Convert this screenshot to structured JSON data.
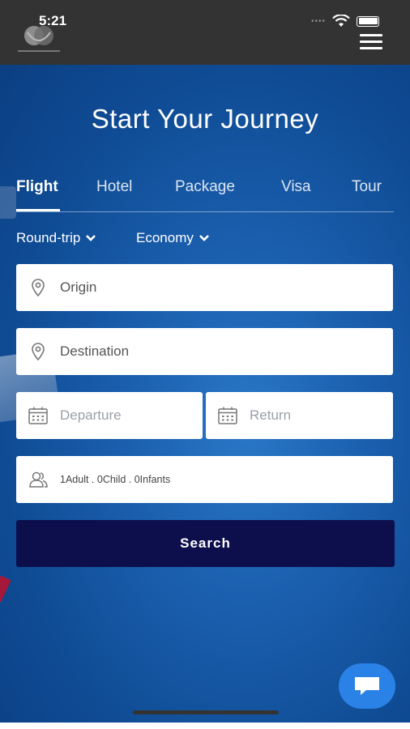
{
  "status_bar": {
    "time": "5:21",
    "dots": "•••• "
  },
  "header": {
    "logo_icon": "company-logo-icon",
    "menu_icon": "hamburger-menu-icon"
  },
  "hero": {
    "title": "Start Your Journey"
  },
  "tabs": [
    {
      "label": "Flight",
      "active": true
    },
    {
      "label": "Hotel",
      "active": false
    },
    {
      "label": "Package",
      "active": false
    },
    {
      "label": "Visa",
      "active": false
    },
    {
      "label": "Tour",
      "active": false
    }
  ],
  "selectors": {
    "trip_type": "Round-trip",
    "cabin_class": "Economy"
  },
  "fields": {
    "origin": "Origin",
    "destination": "Destination",
    "departure": "Departure",
    "return": "Return",
    "travellers": "1Adult . 0Child . 0Infants"
  },
  "search_button": "Search",
  "colors": {
    "topbar": "#333333",
    "hero_blue": "#1a5fae",
    "search_button": "#0d0f4d",
    "chat_button": "#2a82e6"
  }
}
